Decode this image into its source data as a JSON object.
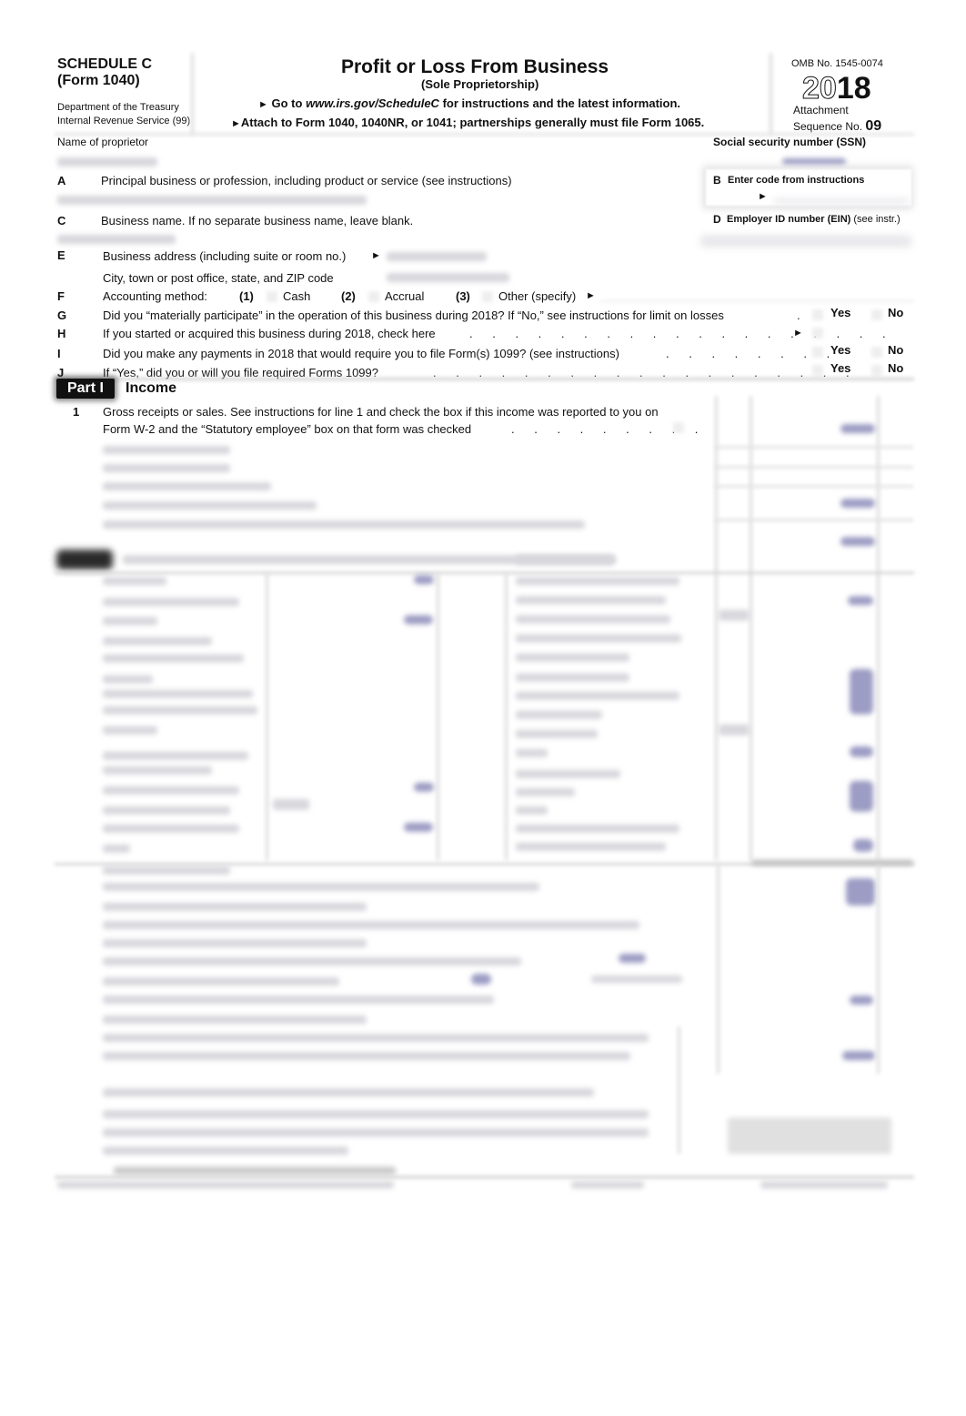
{
  "header": {
    "schedule": "SCHEDULE C",
    "form": "(Form 1040)",
    "dept_line1": "Department of the Treasury",
    "dept_line2": "Internal Revenue Service (99)",
    "title": "Profit or Loss From Business",
    "subtitle": "(Sole Proprietorship)",
    "instruction1_prefix": "Go to ",
    "instruction1_url": "www.irs.gov/ScheduleC",
    "instruction1_suffix": " for instructions and the latest information.",
    "instruction2": "Attach to Form 1040, 1040NR, or 1041; partnerships generally must file Form 1065.",
    "omb": "OMB No. 1545-0074",
    "year_outline": "20",
    "year_solid": "18",
    "attachment": "Attachment",
    "sequence_label": "Sequence No.",
    "sequence_no": "09",
    "arrow": "►"
  },
  "fields": {
    "name_label": "Name of proprietor",
    "ssn_label": "Social security number (SSN)",
    "A_letter": "A",
    "A_label": "Principal business or profession, including product or service (see instructions)",
    "B_letter": "B",
    "B_label": "Enter code from instructions",
    "C_letter": "C",
    "C_label": "Business name. If no separate business name, leave blank.",
    "D_letter": "D",
    "D_label": "Employer ID number (EIN)",
    "D_note": "(see instr.)",
    "E_letter": "E",
    "E_label": "Business address (including suite or room no.)",
    "E_city_label": "City, town or post office, state, and ZIP code",
    "F_letter": "F",
    "F_label": "Accounting method:",
    "F_opt1_num": "(1)",
    "F_opt1": "Cash",
    "F_opt2_num": "(2)",
    "F_opt2": "Accrual",
    "F_opt3_num": "(3)",
    "F_opt3": "Other (specify)",
    "G_letter": "G",
    "G_label": "Did you “materially participate” in the operation of this business during 2018? If “No,” see instructions for limit on losses",
    "H_letter": "H",
    "H_label": "If you started or acquired this business during 2018, check here",
    "I_letter": "I",
    "I_label": "Did you make any payments in 2018 that would require you to file Form(s) 1099? (see instructions)",
    "J_letter": "J",
    "J_label": "If “Yes,” did you or will you file required Forms 1099?",
    "yes": "Yes",
    "no": "No"
  },
  "part1": {
    "badge": "Part I",
    "title": "Income",
    "line1_num": "1",
    "line1_text_a": "Gross receipts or sales. See instructions for line 1 and check the box if this income was reported to you on",
    "line1_text_b": "Form W-2 and the “Statutory employee” box on that form was checked"
  },
  "dot_leader": ". . . . . . . . . . . . . . . . . . ."
}
